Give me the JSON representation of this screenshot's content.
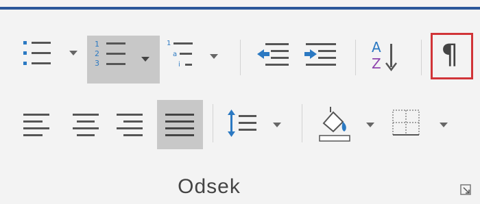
{
  "ribbon_group": {
    "label": "Odsek"
  },
  "colors": {
    "accent_bar": "#2b579a",
    "pressed_background": "#c8c8c8",
    "highlight_border": "#d13438",
    "sort_a": "#2b79c2",
    "sort_z": "#8e44ad",
    "indent_arrow": "#2b79c2"
  },
  "icons": {
    "bullets": "bullets-icon",
    "numbering": "numbering-icon",
    "multilevel": "multilevel-list-icon",
    "decrease_indent": "decrease-indent-icon",
    "increase_indent": "increase-indent-icon",
    "sort": "sort-icon",
    "show_marks": "pilcrow-icon",
    "align_left": "align-left-icon",
    "align_center": "align-center-icon",
    "align_right": "align-right-icon",
    "justify": "justify-icon",
    "line_spacing": "line-spacing-icon",
    "shading": "shading-icon",
    "borders": "borders-icon",
    "dialog_launcher": "dialog-launcher-icon"
  },
  "labels": {
    "numbering_digits": [
      "1",
      "2",
      "3"
    ],
    "multilevel_digits": [
      "1",
      "a",
      "i"
    ],
    "sort_letters": [
      "A",
      "Z"
    ],
    "pilcrow": "¶"
  },
  "state": {
    "numbering_active": true,
    "justify_active": true,
    "show_marks_highlighted": true
  }
}
